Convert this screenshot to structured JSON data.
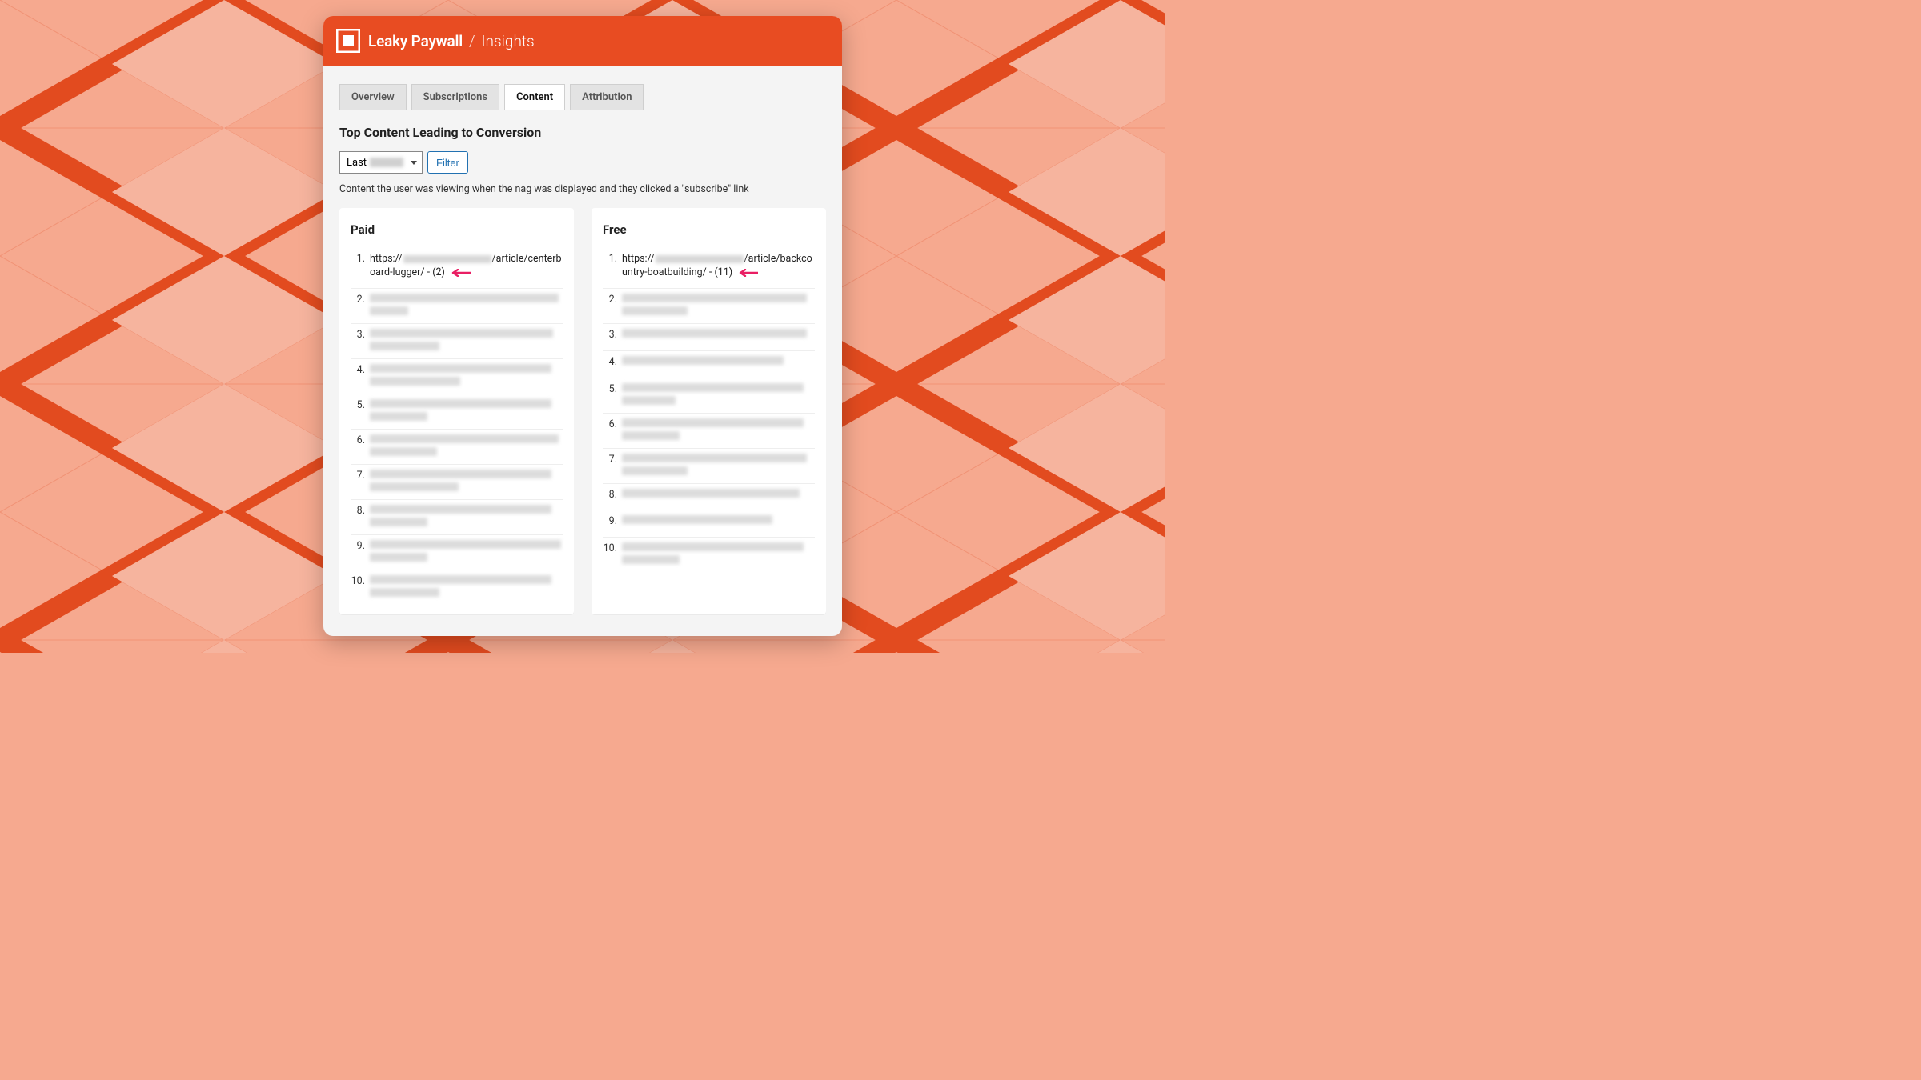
{
  "header": {
    "brand_main": "Leaky Paywall",
    "brand_separator": "/",
    "brand_sub": "Insights"
  },
  "tabs": {
    "overview": "Overview",
    "subscriptions": "Subscriptions",
    "content": "Content",
    "attribution": "Attribution"
  },
  "page": {
    "title": "Top Content Leading to Conversion",
    "select_prefix": "Last",
    "filter_label": "Filter",
    "hint": "Content the user was viewing when the nag was displayed and they clicked a \"subscribe\" link"
  },
  "columns": {
    "paid": {
      "title": "Paid",
      "first_item": {
        "number": "1.",
        "url_prefix": "https://",
        "url_suffix": "/article/centerboard-lugger/ - (2)"
      },
      "rest_numbers": [
        "2.",
        "3.",
        "4.",
        "5.",
        "6.",
        "7.",
        "8.",
        "9.",
        "10."
      ],
      "rest_shapes": [
        [
          "98%",
          "20%"
        ],
        [
          "95%",
          "36%"
        ],
        [
          "94%",
          "47%"
        ],
        [
          "94%",
          "30%"
        ],
        [
          "98%",
          "35%"
        ],
        [
          "94%",
          "46%"
        ],
        [
          "94%",
          "30%"
        ],
        [
          "99%",
          "30%"
        ],
        [
          "94%",
          "36%"
        ]
      ]
    },
    "free": {
      "title": "Free",
      "first_item": {
        "number": "1.",
        "url_prefix": "https://",
        "url_suffix": "/article/backcountry-boatbuilding/ - (11)"
      },
      "rest_numbers": [
        "2.",
        "3.",
        "4.",
        "5.",
        "6.",
        "7.",
        "8.",
        "9.",
        "10."
      ],
      "rest_shapes": [
        [
          "96%",
          "34%"
        ],
        [
          "96%"
        ],
        [
          "84%"
        ],
        [
          "94%",
          "28%"
        ],
        [
          "94%",
          "30%"
        ],
        [
          "96%",
          "34%"
        ],
        [
          "92%"
        ],
        [
          "78%"
        ],
        [
          "94%",
          "30%"
        ]
      ]
    }
  }
}
